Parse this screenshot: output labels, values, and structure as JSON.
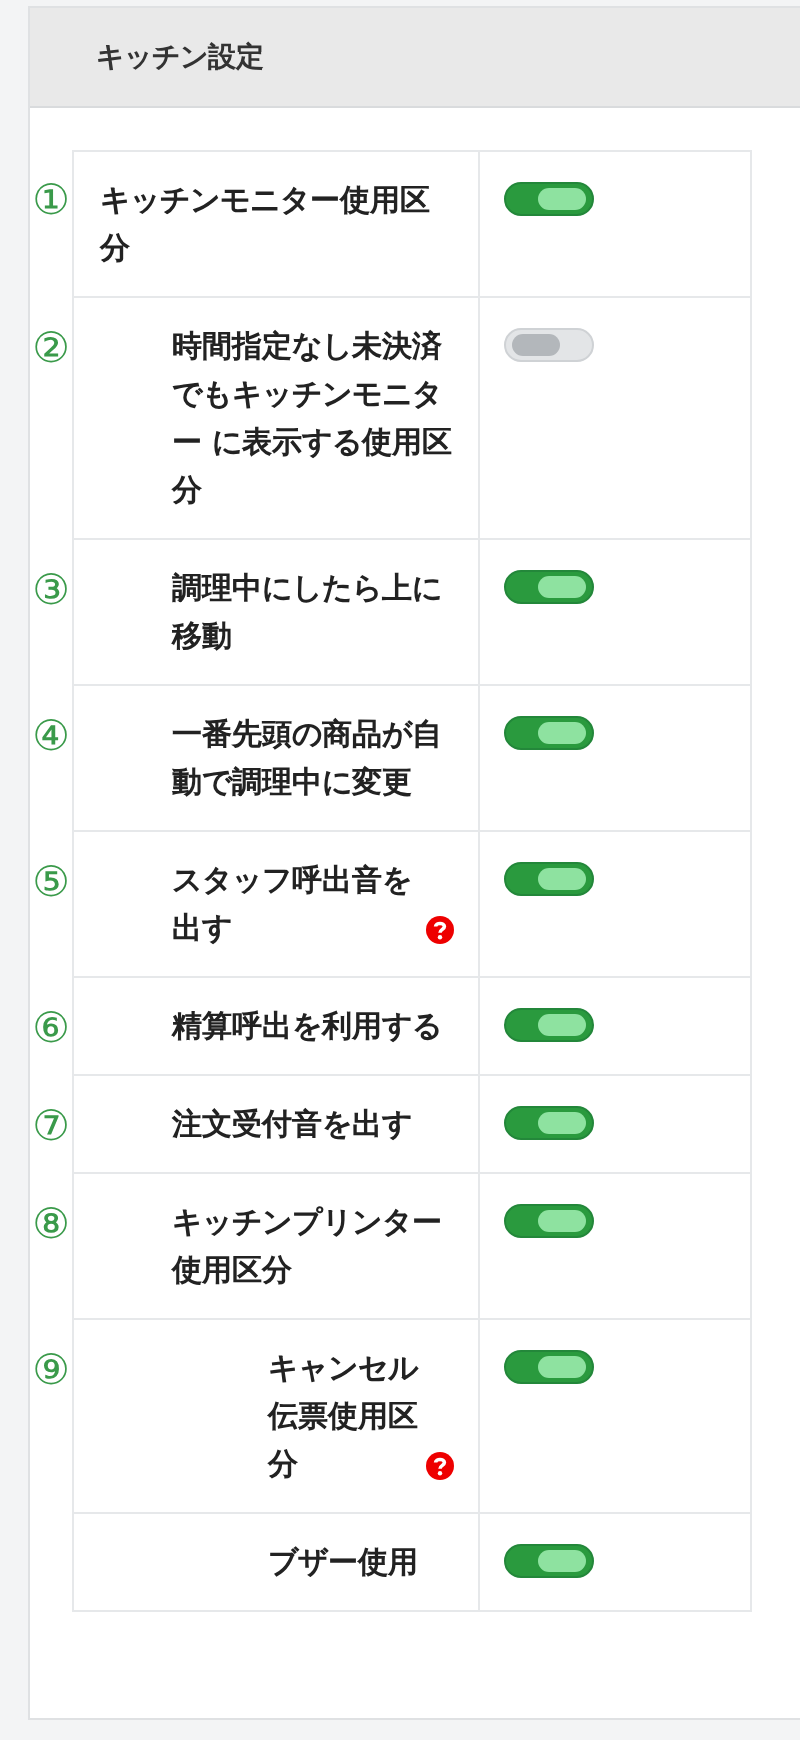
{
  "panel": {
    "title": "キッチン設定"
  },
  "settings": [
    {
      "marker": "①",
      "label": "キッチンモニター使用区分",
      "on": true,
      "help": false,
      "children": [
        {
          "marker": "②",
          "label": "時間指定なし未決済でもキッチンモニター に表示する使用区分",
          "on": false,
          "help": false
        },
        {
          "marker": "③",
          "label": "調理中にしたら上に移動",
          "on": true,
          "help": false
        },
        {
          "marker": "④",
          "label": "一番先頭の商品が自動で調理中に変更",
          "on": true,
          "help": false
        },
        {
          "marker": "⑤",
          "label": "スタッフ呼出音を出す",
          "on": true,
          "help": true
        },
        {
          "marker": "⑥",
          "label": "精算呼出を利用する",
          "on": true,
          "help": false
        },
        {
          "marker": "⑦",
          "label": "注文受付音を出す",
          "on": true,
          "help": false
        },
        {
          "marker": "⑧",
          "label": "キッチンプリンター使用区分",
          "on": true,
          "help": false,
          "children": [
            {
              "marker": "⑨",
              "label": "キャンセル伝票使用区分",
              "on": true,
              "help": true
            },
            {
              "label": "ブザー使用",
              "on": true,
              "help": false
            }
          ]
        }
      ]
    }
  ]
}
